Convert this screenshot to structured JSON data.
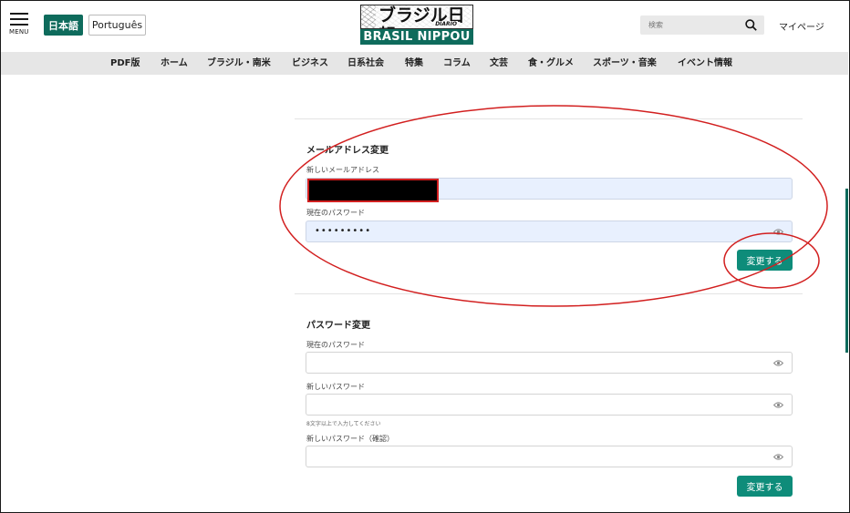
{
  "header": {
    "menu_label": "MENU",
    "lang_ja": "日本語",
    "lang_pt": "Português",
    "logo_jp": "ブラジル日報",
    "logo_diario": "DIARIO",
    "logo_en": "BRASIL NIPPOU",
    "search_placeholder": "検索",
    "mypage": "マイページ"
  },
  "nav": {
    "items": [
      "PDF版",
      "ホーム",
      "ブラジル・南米",
      "ビジネス",
      "日系社会",
      "特集",
      "コラム",
      "文芸",
      "食・グルメ",
      "スポーツ・音楽",
      "イベント情報"
    ]
  },
  "email_section": {
    "title": "メールアドレス変更",
    "new_email_label": "新しいメールアドレス",
    "current_password_label": "現在のパスワード",
    "current_password_value": "•••••••••",
    "submit": "変更する"
  },
  "password_section": {
    "title": "パスワード変更",
    "current_password_label": "現在のパスワード",
    "new_password_label": "新しいパスワード",
    "hint": "8文字以上で入力してください",
    "confirm_label": "新しいパスワード（確認）",
    "submit": "変更する"
  },
  "colors": {
    "brand": "#0e6b5c",
    "button": "#0e8c7a",
    "annotation": "#d21f1f",
    "autofill": "#e8f0fe"
  }
}
